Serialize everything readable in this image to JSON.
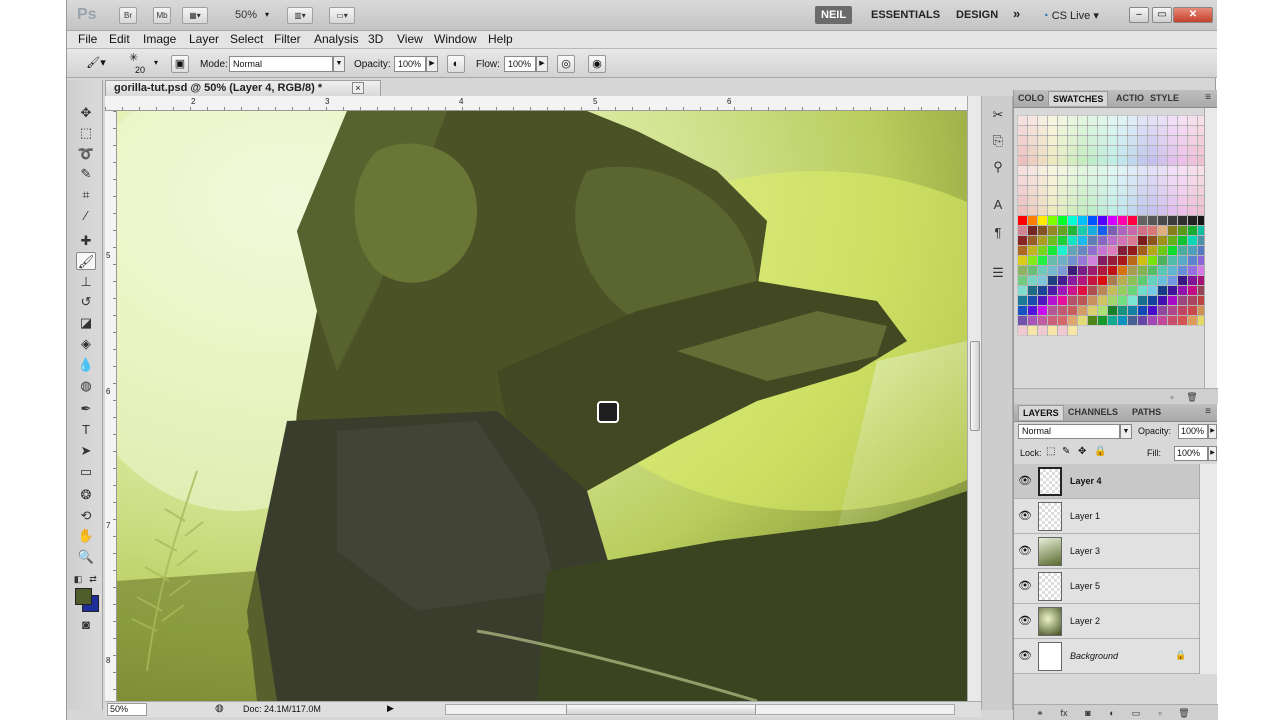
{
  "app": {
    "logo": "Ps",
    "bar_buttons": [
      "Br",
      "Mb"
    ],
    "zoom": "50%",
    "workspaces": [
      "NEIL",
      "ESSENTIALS",
      "DESIGN"
    ],
    "more": "»",
    "cs_live": "CS Live",
    "cs_live_arrow": "▾"
  },
  "menu": [
    "File",
    "Edit",
    "Image",
    "Layer",
    "Select",
    "Filter",
    "Analysis",
    "3D",
    "View",
    "Window",
    "Help"
  ],
  "options": {
    "brush_size": "20",
    "mode_label": "Mode:",
    "mode_value": "Normal",
    "opacity_label": "Opacity:",
    "opacity_value": "100%",
    "flow_label": "Flow:",
    "flow_value": "100%"
  },
  "document": {
    "tab_title": "gorilla-tut.psd @ 50% (Layer 4, RGB/8) *",
    "close": "×",
    "h_ruler": [
      "2",
      "3",
      "4",
      "5",
      "6"
    ],
    "v_ruler": [
      "5",
      "6",
      "7",
      "8"
    ],
    "status_zoom": "50%",
    "status_doc": "Doc: 24.1M/117.0M"
  },
  "swatches_panel": {
    "tabs": [
      "COLO",
      "SWATCHES",
      "ACTIO",
      "STYLE"
    ],
    "menu": "≡"
  },
  "layers_panel": {
    "tabs": [
      "LAYERS",
      "CHANNELS",
      "PATHS"
    ],
    "blend_mode": "Normal",
    "opacity_label": "Opacity:",
    "opacity_value": "100%",
    "lock_label": "Lock:",
    "fill_label": "Fill:",
    "fill_value": "100%",
    "layers": [
      {
        "name": "Layer 4",
        "selected": true
      },
      {
        "name": "Layer 1",
        "selected": false
      },
      {
        "name": "Layer 3",
        "selected": false
      },
      {
        "name": "Layer 5",
        "selected": false
      },
      {
        "name": "Layer 2",
        "selected": false
      },
      {
        "name": "Background",
        "selected": false,
        "locked": true
      }
    ]
  }
}
